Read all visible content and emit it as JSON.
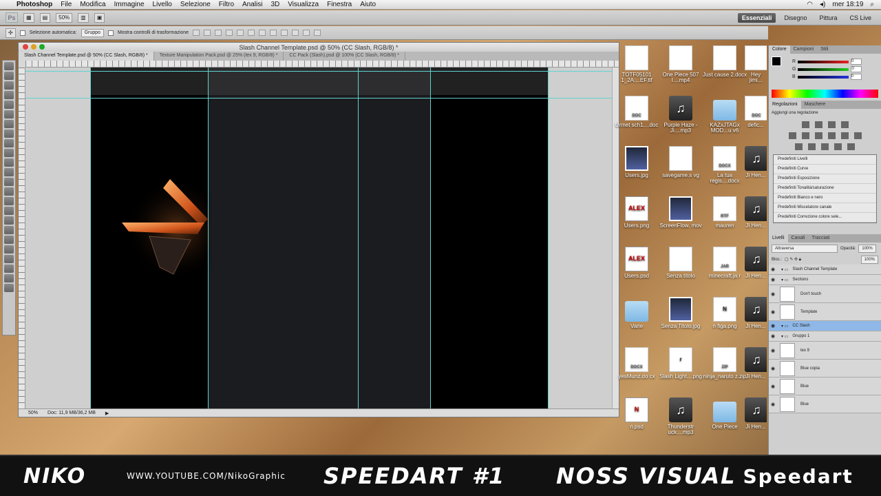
{
  "menubar": {
    "app": "Photoshop",
    "items": [
      "File",
      "Modifica",
      "Immagine",
      "Livello",
      "Selezione",
      "Filtro",
      "Analisi",
      "3D",
      "Visualizza",
      "Finestra",
      "Aiuto"
    ],
    "clock": "mer 18:19"
  },
  "appbar": {
    "zoom": "50%",
    "workspaces": [
      "Essenziali",
      "Disegno",
      "Pittura"
    ],
    "cslive": "CS Live"
  },
  "options": {
    "auto_select": "Selezione automatica:",
    "auto_select_value": "Gruppo",
    "transform_controls": "Mostra controlli di trasformazione"
  },
  "document": {
    "title": "Slash Channel Template.psd @ 50% (CC Slash, RGB/8) *",
    "tabs": [
      "Slash Channel Template.psd @ 50% (CC Slash, RGB/8) *",
      "Texture Manipulation Pack.psd @ 25% (tex 9, RGB/8) *",
      "CC Pack (Slash).psd @ 100% (CC Slash, RGB/8) *"
    ],
    "status_zoom": "50%",
    "status_doc": "Doc: 11,9 MB/36,2 MB"
  },
  "desktop_icons": [
    {
      "label": "TOTF05101 1_2A....EF.tif",
      "kind": "doc",
      "glyph": ""
    },
    {
      "label": "One Piece 507 I....mp4",
      "kind": "doc",
      "glyph": ""
    },
    {
      "label": "Just cause 2.docx",
      "kind": "doc",
      "glyph": ""
    },
    {
      "label": "Hey jimi...",
      "kind": "doc",
      "glyph": ""
    },
    {
      "label": "Urmet sch1....doc",
      "kind": "doc",
      "glyph": "DOC"
    },
    {
      "label": "Purple Haze - Ji....mp3",
      "kind": "music",
      "glyph": "♫"
    },
    {
      "label": "KAZxJTAGx MOD...u v6",
      "kind": "folder",
      "glyph": ""
    },
    {
      "label": "defic...",
      "kind": "doc",
      "glyph": "DOC"
    },
    {
      "label": "Users.jpg",
      "kind": "img",
      "glyph": ""
    },
    {
      "label": "savegame.s vg",
      "kind": "white",
      "glyph": ""
    },
    {
      "label": "La tua regis....docx",
      "kind": "doc",
      "glyph": "DOCX"
    },
    {
      "label": "Ji Hen...",
      "kind": "music",
      "glyph": "♫"
    },
    {
      "label": "Users.png",
      "kind": "alex",
      "glyph": "ALEX"
    },
    {
      "label": "ScreenFlow. mov",
      "kind": "img",
      "glyph": ""
    },
    {
      "label": "mauren",
      "kind": "doc",
      "glyph": "RTF"
    },
    {
      "label": "Ji Hen...",
      "kind": "music",
      "glyph": "♫"
    },
    {
      "label": "Users.psd",
      "kind": "alex",
      "glyph": "ALEX"
    },
    {
      "label": "Senza titolo",
      "kind": "white",
      "glyph": ""
    },
    {
      "label": "minecraft.ja r",
      "kind": "doc",
      "glyph": "JAR"
    },
    {
      "label": "Ji Hen...",
      "kind": "music",
      "glyph": "♫"
    },
    {
      "label": "Varie",
      "kind": "folder",
      "glyph": ""
    },
    {
      "label": "Senza Titolo.jpg",
      "kind": "img",
      "glyph": ""
    },
    {
      "label": "n figa.png",
      "kind": "white",
      "glyph": "N"
    },
    {
      "label": "Ji Hen...",
      "kind": "music",
      "glyph": "♫"
    },
    {
      "label": "yesMunz.do cx",
      "kind": "doc",
      "glyph": "DOCX"
    },
    {
      "label": "Slash Light....png",
      "kind": "white",
      "glyph": "r"
    },
    {
      "label": "ninja_naruto z.zip",
      "kind": "doc",
      "glyph": "ZIP"
    },
    {
      "label": "Ji Hen...",
      "kind": "music",
      "glyph": "♫"
    },
    {
      "label": "n.psd",
      "kind": "alex",
      "glyph": "N"
    },
    {
      "label": "Thunderstr uck....mp3",
      "kind": "music",
      "glyph": "♫"
    },
    {
      "label": "One Piece",
      "kind": "folder",
      "glyph": ""
    },
    {
      "label": "Ji Hen...",
      "kind": "music",
      "glyph": "♫"
    }
  ],
  "color_panel": {
    "tabs": [
      "Colore",
      "Campioni",
      "Stili"
    ],
    "sliders": [
      {
        "label": "R",
        "value": "0",
        "color": "#e22"
      },
      {
        "label": "G",
        "value": "0",
        "color": "#2c2"
      },
      {
        "label": "B",
        "value": "0",
        "color": "#23d"
      }
    ]
  },
  "adjust_panel": {
    "tabs": [
      "Regolazioni",
      "Maschere"
    ],
    "title": "Aggiungi una regolazione",
    "presets": [
      "Predefiniti Livelli",
      "Predefiniti Curve",
      "Predefiniti Esposizione",
      "Predefiniti Tonalità/saturazione",
      "Predefiniti Bianco e nero",
      "Predefiniti Miscelatore canale",
      "Predefiniti Correzione colore sele..."
    ]
  },
  "layers_panel": {
    "tabs": [
      "Livelli",
      "Canali",
      "Tracciati"
    ],
    "blend": "Attraversa",
    "opacity_label": "Opacità:",
    "opacity": "100%",
    "lock_label": "Bloc.:",
    "fill": "100%",
    "layers": [
      {
        "name": "Slash Channel Template",
        "type": "group",
        "selected": false
      },
      {
        "name": "Sections",
        "type": "group",
        "selected": false
      },
      {
        "name": "Don't touch",
        "type": "layer",
        "selected": false
      },
      {
        "name": "Template",
        "type": "layer",
        "selected": false
      },
      {
        "name": "CC Slash",
        "type": "group",
        "selected": true
      },
      {
        "name": "Gruppo 1",
        "type": "group",
        "selected": false
      },
      {
        "name": "tex 9",
        "type": "layer",
        "selected": false
      },
      {
        "name": "Blue copia",
        "type": "layer",
        "selected": false
      },
      {
        "name": "Blue",
        "type": "layer",
        "selected": false
      },
      {
        "name": "Blue",
        "type": "layer",
        "selected": false
      }
    ]
  },
  "banner": {
    "name": "NIKO",
    "url": "WWW.YOUTUBE.COM/NikoGraphic",
    "title": "SPEEDART #1",
    "right1": "NOSS VISUAL",
    "right2": "Speedart"
  }
}
